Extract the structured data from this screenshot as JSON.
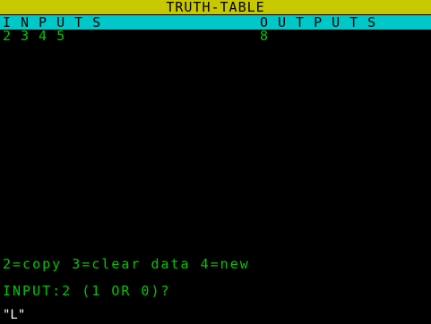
{
  "title": "TRUTH-TABLE",
  "header": {
    "inputs_label": "INPUTS",
    "outputs_label": "OUTPUTS"
  },
  "row": {
    "inputs": "2345",
    "output": "8"
  },
  "menu": "2=copy 3=clear data 4=new",
  "prompt": "INPUT:2 (1 OR 0)?",
  "cursor": "\"L\"",
  "colors": {
    "title_bg": "#c8c800",
    "header_bg": "#00c8c8",
    "text_green": "#00c800",
    "screen_bg": "#000000"
  }
}
